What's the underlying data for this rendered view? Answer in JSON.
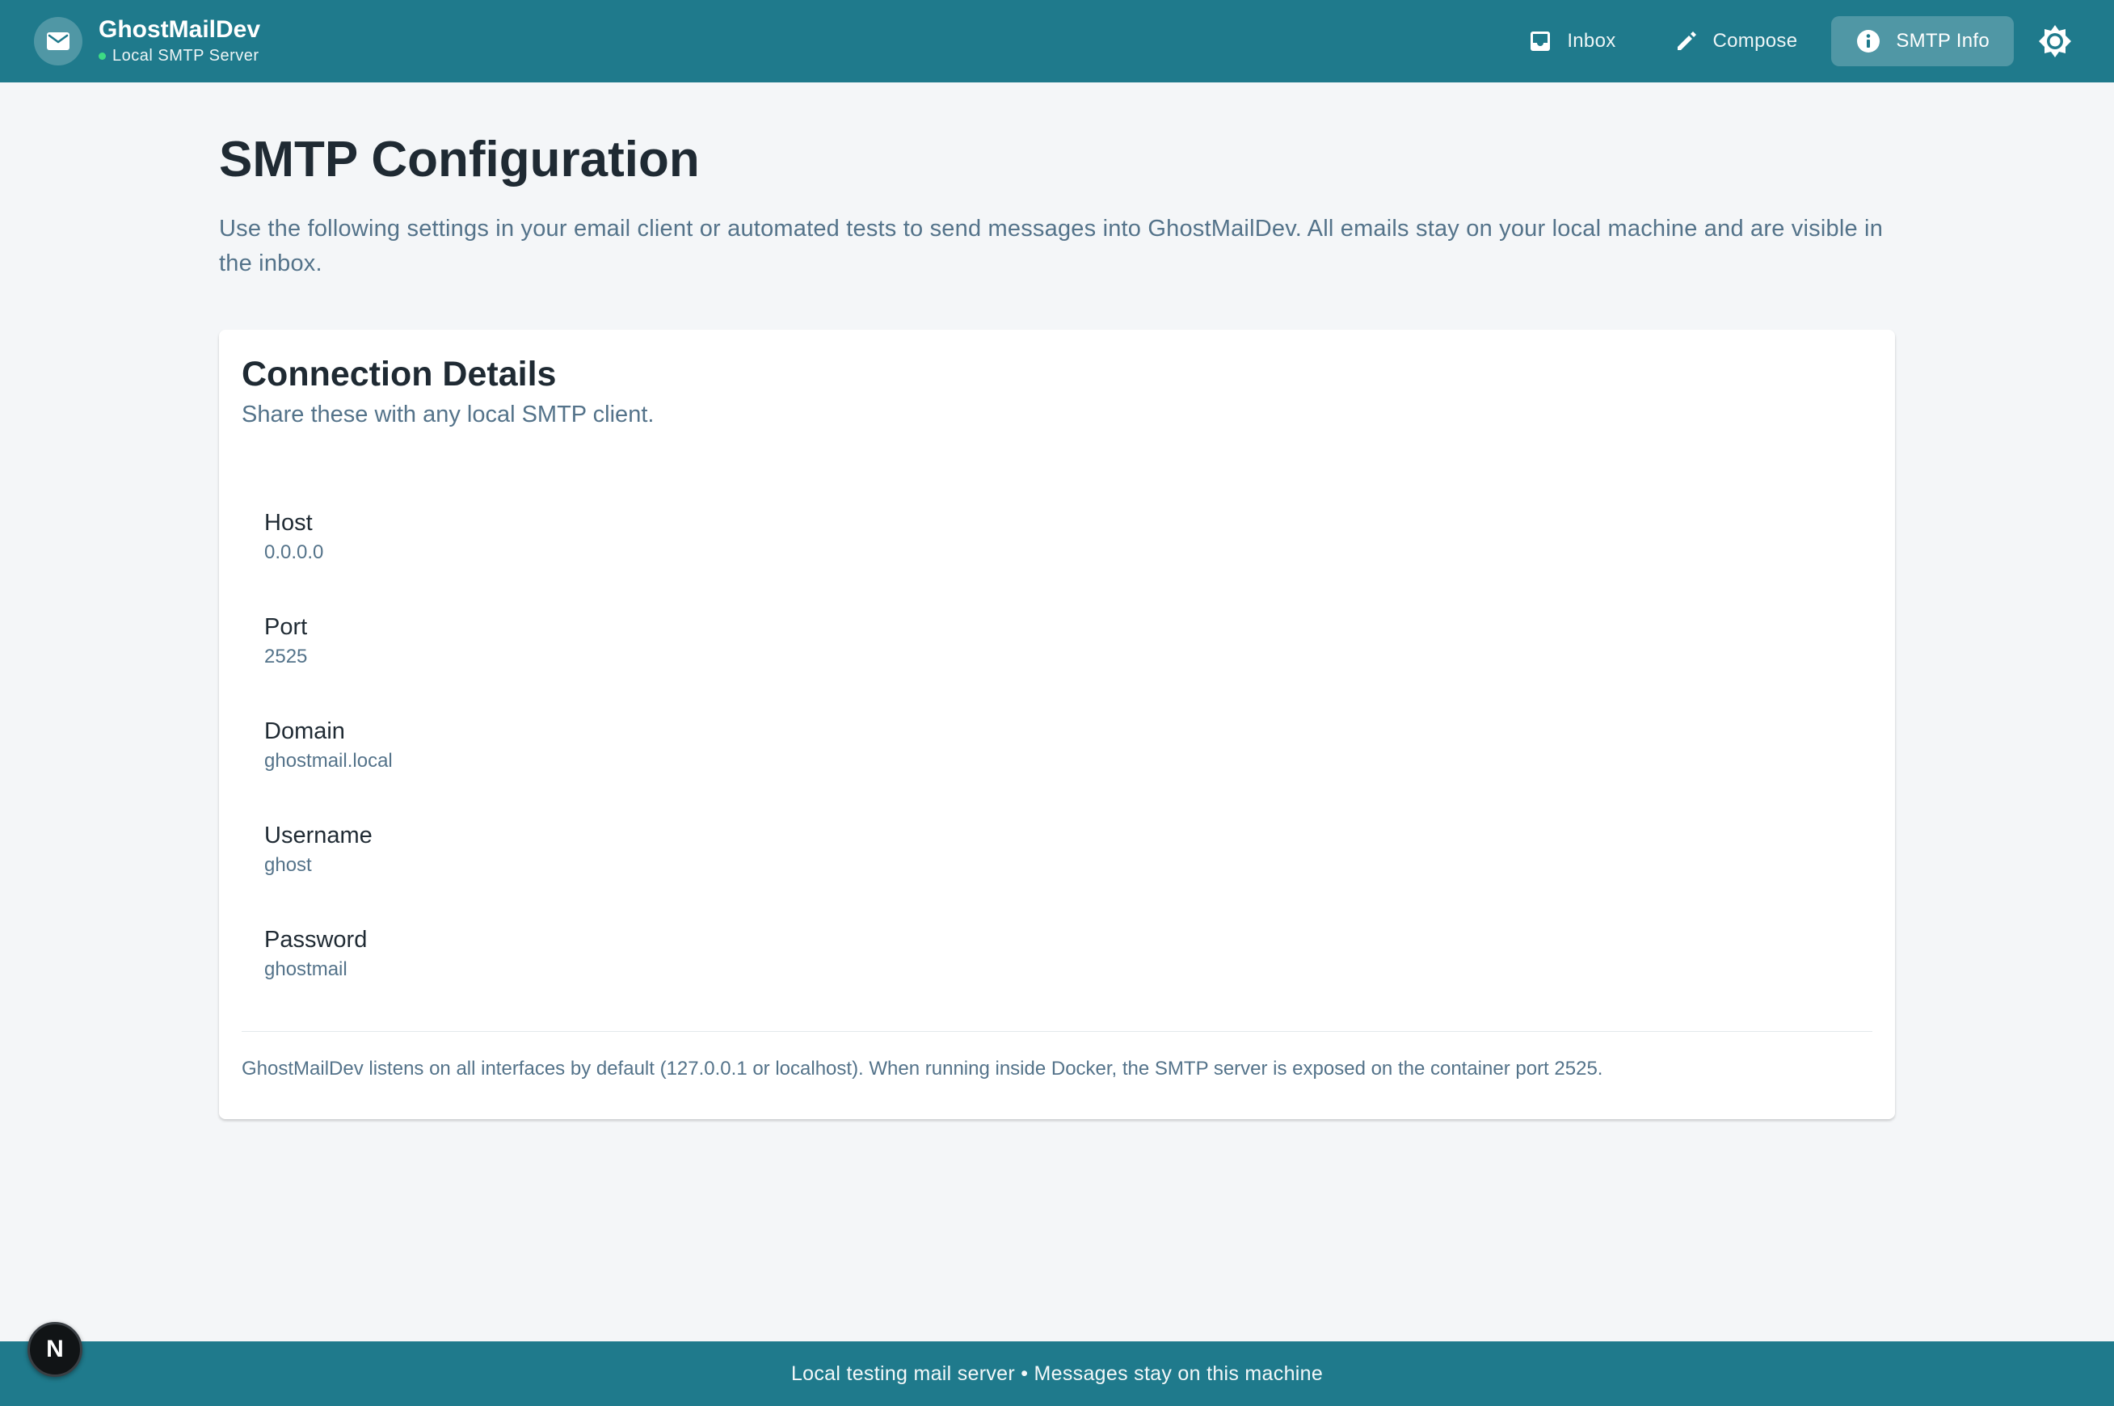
{
  "brand": {
    "title": "GhostMailDev",
    "subtitle": "Local SMTP Server",
    "logo_icon": "mail-icon"
  },
  "nav": {
    "items": [
      {
        "label": "Inbox",
        "icon": "inbox-icon",
        "active": false
      },
      {
        "label": "Compose",
        "icon": "pencil-icon",
        "active": false
      },
      {
        "label": "SMTP Info",
        "icon": "info-icon",
        "active": true
      }
    ],
    "theme_toggle_icon": "sun-icon"
  },
  "page": {
    "title": "SMTP Configuration",
    "description": "Use the following settings in your email client or automated tests to send messages into GhostMailDev. All emails stay on your local machine and are visible in the inbox."
  },
  "card": {
    "title": "Connection Details",
    "subtitle": "Share these with any local SMTP client.",
    "fields": [
      {
        "label": "Host",
        "value": "0.0.0.0"
      },
      {
        "label": "Port",
        "value": "2525"
      },
      {
        "label": "Domain",
        "value": "ghostmail.local"
      },
      {
        "label": "Username",
        "value": "ghost"
      },
      {
        "label": "Password",
        "value": "ghostmail"
      }
    ],
    "note": "GhostMailDev listens on all interfaces by default (127.0.0.1 or localhost). When running inside Docker, the SMTP server is exposed on the container port 2525."
  },
  "footer": {
    "text": "Local testing mail server • Messages stay on this machine"
  },
  "dev_badge": {
    "label": "N"
  },
  "colors": {
    "primary": "#1f7a8c",
    "background": "#f4f6f8",
    "muted_text": "#54738a",
    "status_online": "#3ddc84"
  }
}
